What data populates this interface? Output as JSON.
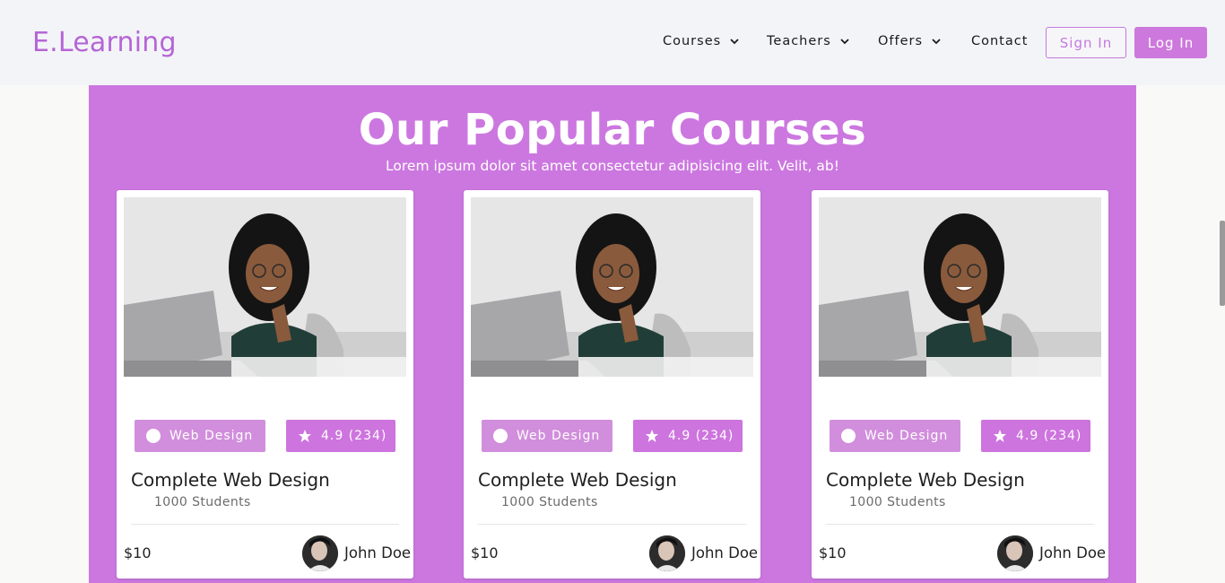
{
  "header": {
    "brand": "E.Learning",
    "nav": [
      {
        "label": "Courses",
        "dropdown": true,
        "icon": "chevron-down-icon"
      },
      {
        "label": "Teachers",
        "dropdown": true,
        "icon": "chevron-down-icon"
      },
      {
        "label": "Offers",
        "dropdown": true,
        "icon": "chevron-down-icon"
      },
      {
        "label": "Contact",
        "dropdown": false
      }
    ],
    "sign_in_label": "Sign In",
    "log_in_label": "Log In"
  },
  "section": {
    "title": "Our Popular Courses",
    "subtitle": "Lorem ipsum dolor sit amet consectetur adipisicing elit. Velit, ab!"
  },
  "courses": [
    {
      "category": "Web Design",
      "rating": "4.9 (234)",
      "title": "Complete Web Design",
      "students": "1000 Students",
      "price": "$10",
      "teacher": "John Doe"
    },
    {
      "category": "Web Design",
      "rating": "4.9 (234)",
      "title": "Complete Web Design",
      "students": "1000 Students",
      "price": "$10",
      "teacher": "John Doe"
    },
    {
      "category": "Web Design",
      "rating": "4.9 (234)",
      "title": "Complete Web Design",
      "students": "1000 Students",
      "price": "$10",
      "teacher": "John Doe"
    }
  ],
  "colors": {
    "brand": "#b565d6",
    "accent": "#cd78dc",
    "section_bg": "#cc77e0",
    "category_tag": "#d18edc"
  }
}
